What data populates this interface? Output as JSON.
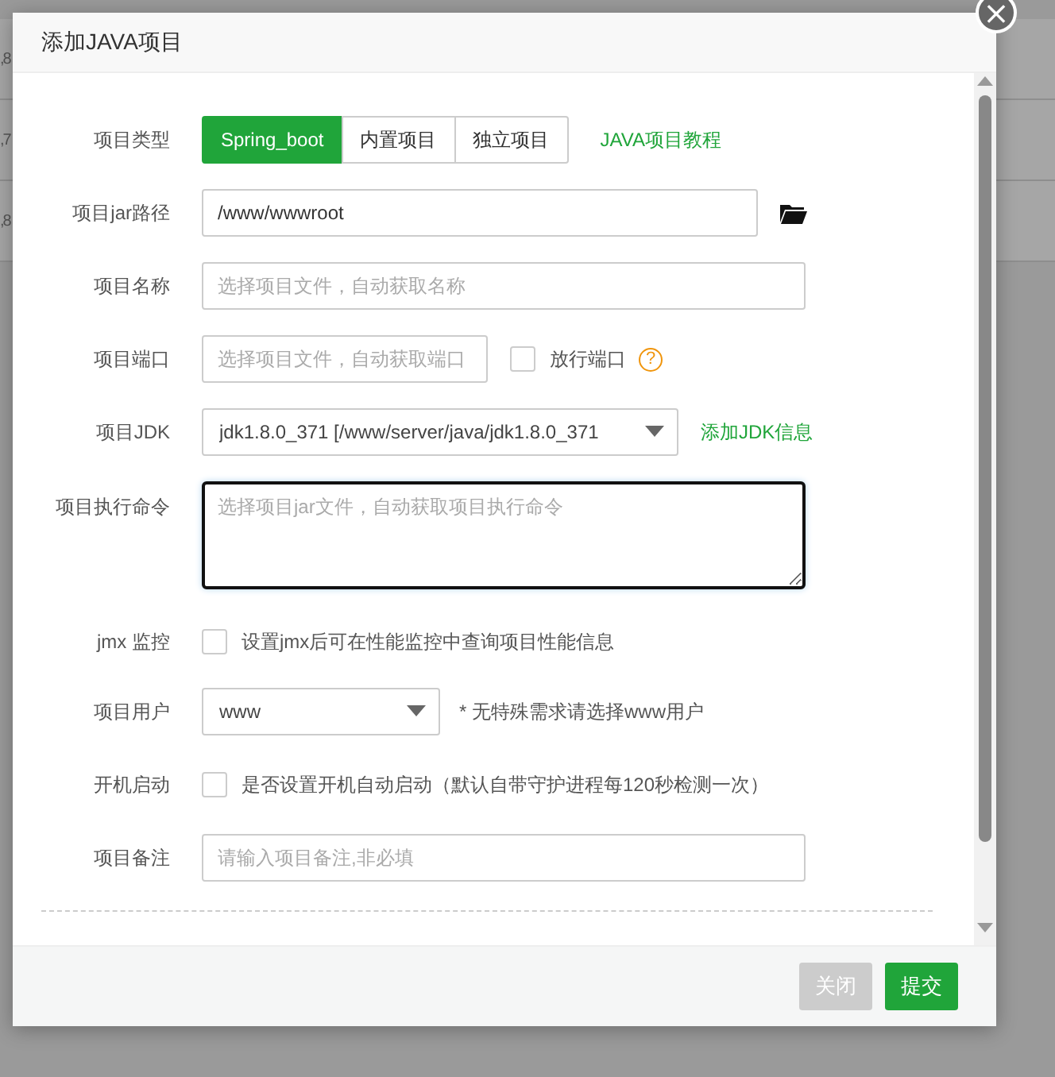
{
  "background_rows": [
    {
      "cell": ",8"
    },
    {
      "cell": ",7"
    },
    {
      "cell": ",8"
    }
  ],
  "dialog": {
    "title": "添加JAVA项目",
    "close": "×",
    "form": [
      {
        "kind": "segmented",
        "label": "项目类型",
        "options": [
          {
            "label": "Spring_boot",
            "selected": true
          },
          {
            "label": "内置项目",
            "selected": false
          },
          {
            "label": "独立项目",
            "selected": false
          }
        ],
        "link": "JAVA项目教程"
      },
      {
        "kind": "path",
        "label": "项目jar路径",
        "value": "/www/wwwroot"
      },
      {
        "kind": "text",
        "label": "项目名称",
        "placeholder": "选择项目文件，自动获取名称"
      },
      {
        "kind": "port",
        "label": "项目端口",
        "placeholder": "选择项目文件，自动获取端口",
        "checkbox": {
          "label": "放行端口",
          "checked": false
        },
        "help": "?"
      },
      {
        "kind": "select",
        "label": "项目JDK",
        "value": "jdk1.8.0_371 [/www/server/java/jdk1.8.0_371",
        "link": "添加JDK信息"
      },
      {
        "kind": "textarea",
        "label": "项目执行命令",
        "placeholder": "选择项目jar文件，自动获取项目执行命令",
        "focused": true
      },
      {
        "kind": "checkbox",
        "label": "jmx 监控",
        "text": "设置jmx后可在性能监控中查询项目性能信息",
        "checked": false
      },
      {
        "kind": "short-select",
        "label": "项目用户",
        "value": "www",
        "note": "* 无特殊需求请选择www用户"
      },
      {
        "kind": "checkbox",
        "label": "开机启动",
        "text": "是否设置开机自动启动（默认自带守护进程每120秒检测一次）",
        "checked": false
      },
      {
        "kind": "text",
        "label": "项目备注",
        "placeholder": "请输入项目备注,非必填"
      }
    ],
    "buttons": [
      {
        "label": "关闭",
        "kind": "secondary"
      },
      {
        "label": "提交",
        "kind": "primary"
      }
    ]
  }
}
